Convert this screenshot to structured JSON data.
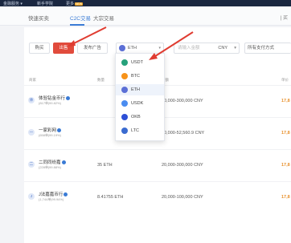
{
  "topbar": {
    "items": [
      "金融服务 ▾",
      "新手学院",
      "更多"
    ],
    "more_badge": "NEW"
  },
  "tabs": {
    "items": [
      "快速买卖",
      "C2C交易",
      "大宗交易"
    ],
    "active_index": 1,
    "right_text": "| 买"
  },
  "filters": {
    "buy_label": "购买",
    "sell_label": "出售",
    "publish_label": "发布广告",
    "coin_selected": "ETH",
    "amount_placeholder": "请输入金额",
    "amount_unit": "CNY",
    "payment_label": "所有支付方式"
  },
  "coin_dropdown": {
    "options": [
      {
        "label": "USDT",
        "color": "#26a17b"
      },
      {
        "label": "BTC",
        "color": "#f7931a"
      },
      {
        "label": "ETH",
        "color": "#5b6fd6"
      },
      {
        "label": "USDK",
        "color": "#4a8cf0"
      },
      {
        "label": "OKB",
        "color": "#2d4fd6"
      },
      {
        "label": "LTC",
        "color": "#3a6bd0"
      }
    ],
    "hovered_index": 2
  },
  "table": {
    "headers": [
      "商家",
      "数量",
      "限额",
      "单价"
    ],
    "rows": [
      {
        "icon": "体",
        "name": "体验钻金币行",
        "stats": "(817单|99.82%)",
        "qty": "",
        "limit": "20,000-300,000 CNY",
        "price": "17,8"
      },
      {
        "icon": "一",
        "name": "一家彩网",
        "stats": "(658单|99.19%)",
        "qty": "",
        "limit": "30,000-52,560.9 CNY",
        "price": "17,8"
      },
      {
        "icon": "二",
        "name": "二同同纷嘉",
        "stats": "(228单|99.88%)",
        "qty": "35 ETH",
        "limit": "20,000-300,000 CNY",
        "price": "17,8"
      },
      {
        "icon": "J",
        "name": "J法嘉嘉币行",
        "stats": "(1,744单|99.94%)",
        "qty": "8.41755 ETH",
        "limit": "20,000-100,000 CNY",
        "price": "17,8"
      }
    ]
  },
  "colors": {
    "sell": "#e14b3c",
    "accent": "#3a7bd5",
    "price": "#e8912d",
    "arrow": "#e03c31"
  }
}
